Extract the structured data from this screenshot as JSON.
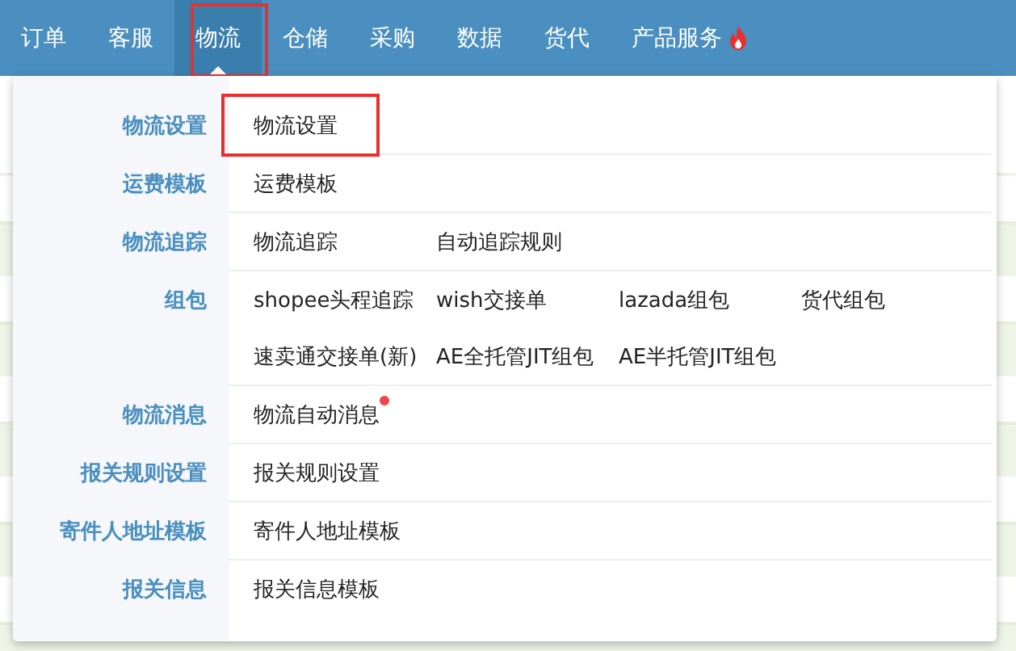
{
  "nav": [
    {
      "label": "订单",
      "selected": false,
      "highlighted": false,
      "hot": false
    },
    {
      "label": "客服",
      "selected": false,
      "highlighted": false,
      "hot": false
    },
    {
      "label": "物流",
      "selected": true,
      "highlighted": true,
      "hot": false
    },
    {
      "label": "仓储",
      "selected": false,
      "highlighted": false,
      "hot": false
    },
    {
      "label": "采购",
      "selected": false,
      "highlighted": false,
      "hot": false
    },
    {
      "label": "数据",
      "selected": false,
      "highlighted": false,
      "hot": false
    },
    {
      "label": "货代",
      "selected": false,
      "highlighted": false,
      "hot": false
    },
    {
      "label": "产品服务",
      "selected": false,
      "highlighted": false,
      "hot": true
    }
  ],
  "menu": {
    "groups": [
      {
        "label": "物流设置",
        "links": [
          {
            "label": "物流设置",
            "highlighted": true,
            "dot": false
          }
        ]
      },
      {
        "label": "运费模板",
        "links": [
          {
            "label": "运费模板",
            "highlighted": false,
            "dot": false
          }
        ]
      },
      {
        "label": "物流追踪",
        "links": [
          {
            "label": "物流追踪",
            "highlighted": false,
            "dot": false
          },
          {
            "label": "自动追踪规则",
            "highlighted": false,
            "dot": false
          }
        ]
      },
      {
        "label": "组包",
        "links": [
          {
            "label": "shopee头程追踪",
            "highlighted": false,
            "dot": false
          },
          {
            "label": "wish交接单",
            "highlighted": false,
            "dot": false
          },
          {
            "label": "lazada组包",
            "highlighted": false,
            "dot": false
          },
          {
            "label": "货代组包",
            "highlighted": false,
            "dot": false
          },
          {
            "label": "速卖通交接单(新)",
            "highlighted": false,
            "dot": false
          },
          {
            "label": "AE全托管JIT组包",
            "highlighted": false,
            "dot": false
          },
          {
            "label": "AE半托管JIT组包",
            "highlighted": false,
            "dot": false
          }
        ]
      },
      {
        "label": "物流消息",
        "links": [
          {
            "label": "物流自动消息",
            "highlighted": false,
            "dot": true
          }
        ]
      },
      {
        "label": "报关规则设置",
        "links": [
          {
            "label": "报关规则设置",
            "highlighted": false,
            "dot": false
          }
        ]
      },
      {
        "label": "寄件人地址模板",
        "links": [
          {
            "label": "寄件人地址模板",
            "highlighted": false,
            "dot": false
          }
        ]
      },
      {
        "label": "报关信息",
        "links": [
          {
            "label": "报关信息模板",
            "highlighted": false,
            "dot": false
          }
        ]
      }
    ]
  }
}
